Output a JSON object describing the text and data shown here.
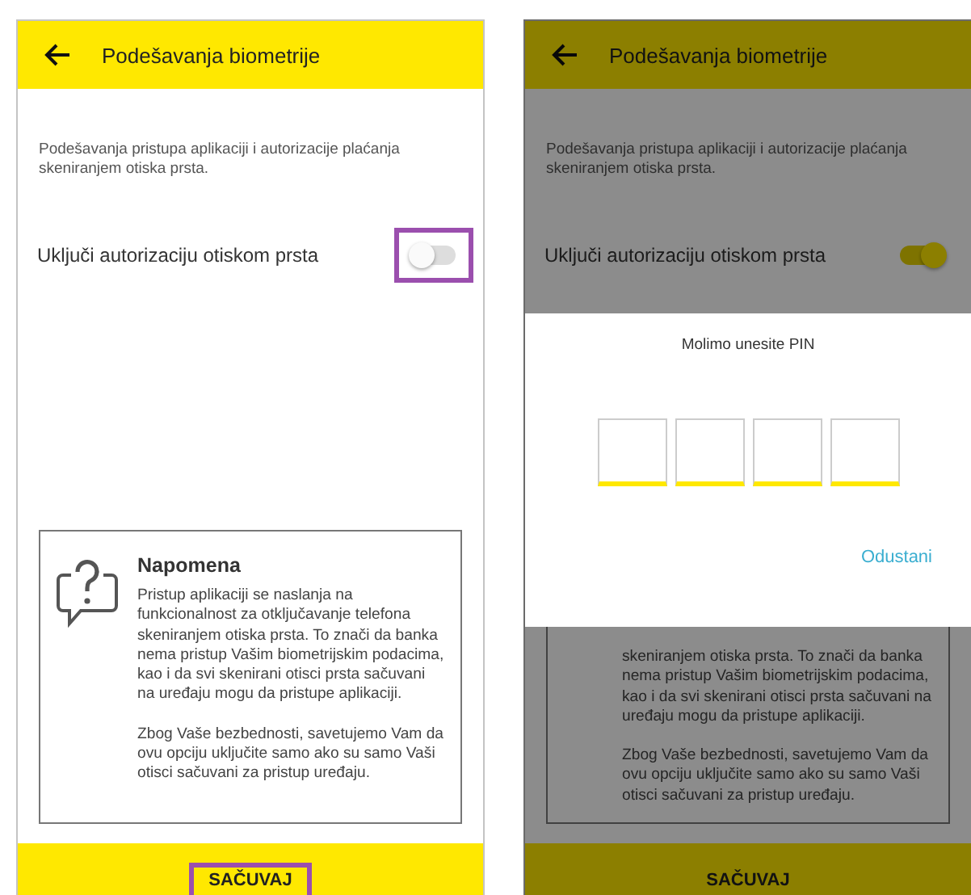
{
  "screens": [
    {
      "header": {
        "title": "Podešavanja biometrije"
      },
      "description": "Podešavanja pristupa aplikaciji i autorizacije plaćanja skeniranjem otiska prsta.",
      "toggle": {
        "label": "Uključi autorizaciju otiskom prsta",
        "on": false,
        "highlighted": true
      },
      "note": {
        "title": "Napomena",
        "paragraphs": [
          "Pristup aplikaciji se naslanja na funkcionalnost za otključavanje telefona skeniranjem otiska prsta. To znači da banka nema pristup Vašim biometrijskim podacima, kao i da svi skenirani otisci prsta sačuvani na uređaju mogu da pristupe aplikaciji.",
          "Zbog Vaše bezbednosti, savetujemo Vam da ovu opciju uključite samo ako su samo Vaši otisci sačuvani za pristup uređaju."
        ]
      },
      "save_button": {
        "label": "SAČUVAJ",
        "highlighted": true
      }
    },
    {
      "header": {
        "title": "Podešavanja biometrije"
      },
      "description": "Podešavanja pristupa aplikaciji i autorizacije plaćanja skeniranjem otiska prsta.",
      "toggle": {
        "label": "Uključi autorizaciju otiskom prsta",
        "on": true,
        "highlighted": false
      },
      "note": {
        "paragraphs": [
          "skeniranjem otiska prsta. To znači da banka nema pristup Vašim biometrijskim podacima, kao i da svi skenirani otisci prsta sačuvani na uređaju mogu da pristupe aplikaciji.",
          "Zbog Vaše bezbednosti, savetujemo Vam da ovu opciju uključite samo ako su samo Vaši otisci sačuvani za pristup uređaju."
        ]
      },
      "save_button": {
        "label": "SAČUVAJ",
        "highlighted": false
      },
      "pin_dialog": {
        "title": "Molimo unesite PIN",
        "pin_boxes": [
          {
            "filled": false
          },
          {
            "filled": false
          },
          {
            "filled": false
          },
          {
            "filled": false
          }
        ],
        "cancel_button": "Odustani"
      }
    }
  ]
}
